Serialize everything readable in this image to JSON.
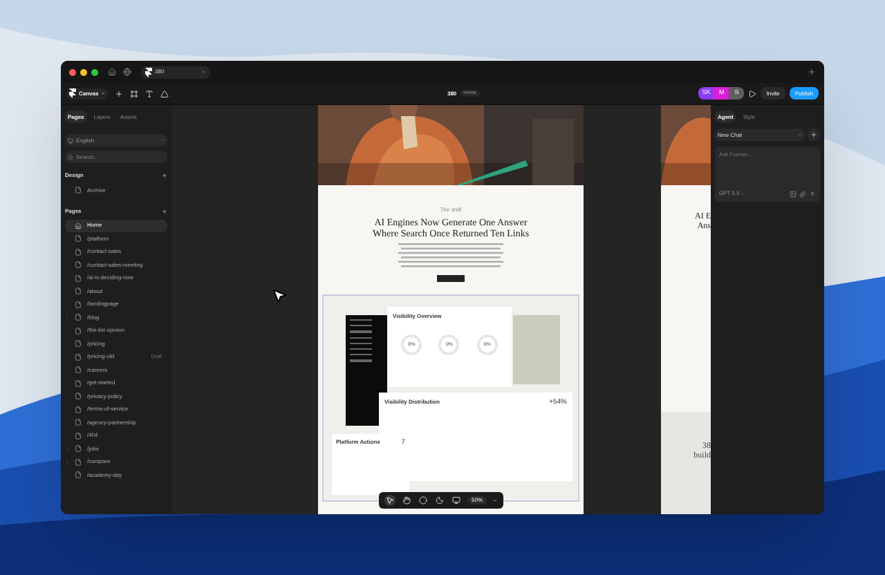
{
  "tab": {
    "title": "380"
  },
  "toolbar": {
    "mode": "Canvas",
    "project": "380",
    "page": "Home",
    "invite": "Invite",
    "publish": "Publish",
    "avatars": [
      {
        "initials": "SK",
        "color": "#8e3cf2"
      },
      {
        "initials": "M",
        "color": "#d81fd8"
      },
      {
        "initials": "S",
        "color": "#5f5f5f"
      }
    ]
  },
  "sidebar": {
    "tabs": [
      {
        "label": "Pages",
        "selected": true
      },
      {
        "label": "Layers",
        "selected": false
      },
      {
        "label": "Assets",
        "selected": false
      }
    ],
    "locale": "English",
    "search_placeholder": "Search...",
    "design": {
      "title": "Design",
      "items": [
        {
          "label": "Archive",
          "kind": "page",
          "selected": false
        }
      ]
    },
    "pages": {
      "title": "Pages",
      "items": [
        {
          "label": "Home",
          "kind": "home",
          "selected": true
        },
        {
          "label": "/platform",
          "kind": "page",
          "selected": false
        },
        {
          "label": "/contact-sales",
          "kind": "page",
          "selected": false
        },
        {
          "label": "/contact-sales-meeting",
          "kind": "page",
          "selected": false
        },
        {
          "label": "/ai-is-deciding-now",
          "kind": "page",
          "selected": false
        },
        {
          "label": "/about",
          "kind": "page",
          "selected": false
        },
        {
          "label": "/landingpage",
          "kind": "page",
          "selected": false
        },
        {
          "label": "/blog",
          "kind": "folder",
          "selected": false
        },
        {
          "label": "/the-list-opinion",
          "kind": "page",
          "selected": false
        },
        {
          "label": "/pricing",
          "kind": "page",
          "selected": false
        },
        {
          "label": "/pricing-old",
          "kind": "page",
          "selected": false,
          "badge": "Draft"
        },
        {
          "label": "/careers",
          "kind": "page",
          "selected": false
        },
        {
          "label": "/get-started",
          "kind": "page",
          "selected": false
        },
        {
          "label": "/privacy-policy",
          "kind": "page",
          "selected": false
        },
        {
          "label": "/terms-of-service",
          "kind": "page",
          "selected": false
        },
        {
          "label": "/agency-partnership",
          "kind": "page",
          "selected": false
        },
        {
          "label": "/404",
          "kind": "page",
          "selected": false
        },
        {
          "label": "/jobs",
          "kind": "folder",
          "selected": false
        },
        {
          "label": "/compare",
          "kind": "folder",
          "selected": false
        },
        {
          "label": "/academy-day",
          "kind": "page",
          "selected": false
        }
      ]
    }
  },
  "preview": {
    "eyebrow": "The shift",
    "heading": "AI Engines Now Generate One Answer Where Search Once Returned Ten Links",
    "dashboard": {
      "overview_title": "Visibility Overview",
      "gauges": [
        "0%",
        "0%",
        "0%"
      ],
      "distribution_title": "Visibility Distribution",
      "change": "+54%",
      "actions_title": "Platform Actions",
      "actions_count": "7"
    }
  },
  "second_preview": {
    "heading_lines": [
      "AI E",
      "Ans"
    ],
    "footer_lines": [
      "38",
      "build"
    ]
  },
  "zoom_toolbar": {
    "tools": [
      {
        "kind": "pointer",
        "selected": true
      },
      {
        "kind": "hand",
        "selected": false
      },
      {
        "kind": "circle",
        "selected": false
      },
      {
        "kind": "moon",
        "selected": false
      },
      {
        "kind": "screen",
        "selected": false
      }
    ],
    "zoom": "50%"
  },
  "agent_panel": {
    "tabs": [
      {
        "label": "Agent",
        "selected": true
      },
      {
        "label": "Style",
        "selected": false
      }
    ],
    "chat": "New Chat",
    "placeholder": "Ask Framer...",
    "model": "GPT 5.5"
  }
}
